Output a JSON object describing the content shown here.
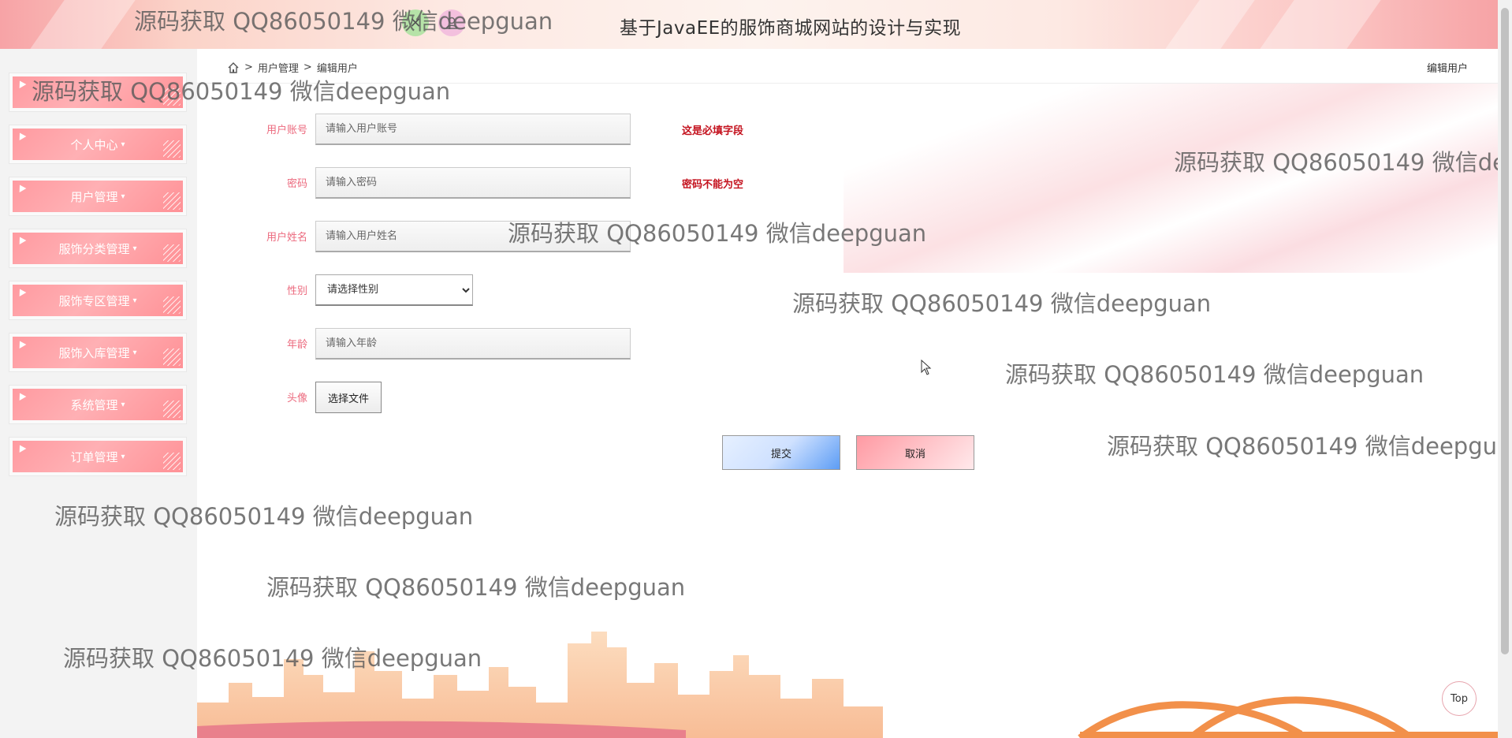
{
  "header": {
    "title": "基于JavaEE的服饰商城网站的设计与实现"
  },
  "sidebar": {
    "items": [
      {
        "label": ""
      },
      {
        "label": "个人中心"
      },
      {
        "label": "用户管理"
      },
      {
        "label": "服饰分类管理"
      },
      {
        "label": "服饰专区管理"
      },
      {
        "label": "服饰入库管理"
      },
      {
        "label": "系统管理"
      },
      {
        "label": "订单管理"
      }
    ],
    "caret": "▾"
  },
  "breadcrumb": {
    "items": [
      "用户管理",
      "编辑用户"
    ],
    "separator": ">",
    "right_title": "编辑用户"
  },
  "form": {
    "account": {
      "label": "用户账号",
      "placeholder": "请输入用户账号",
      "error": "这是必填字段"
    },
    "password": {
      "label": "密码",
      "placeholder": "请输入密码",
      "error": "密码不能为空"
    },
    "name": {
      "label": "用户姓名",
      "placeholder": "请输入用户姓名"
    },
    "gender": {
      "label": "性别",
      "selected": "请选择性别"
    },
    "age": {
      "label": "年龄",
      "placeholder": "请输入年龄"
    },
    "avatar": {
      "label": "头像",
      "button": "选择文件"
    },
    "submit": "提交",
    "cancel": "取消"
  },
  "top_button": "Top",
  "watermark_text": "源码获取 QQ86050149 微信deepguan",
  "colors": {
    "label": "#ec6a7e",
    "error": "#c4121e",
    "sidebar_item": "#ff9aa0"
  }
}
